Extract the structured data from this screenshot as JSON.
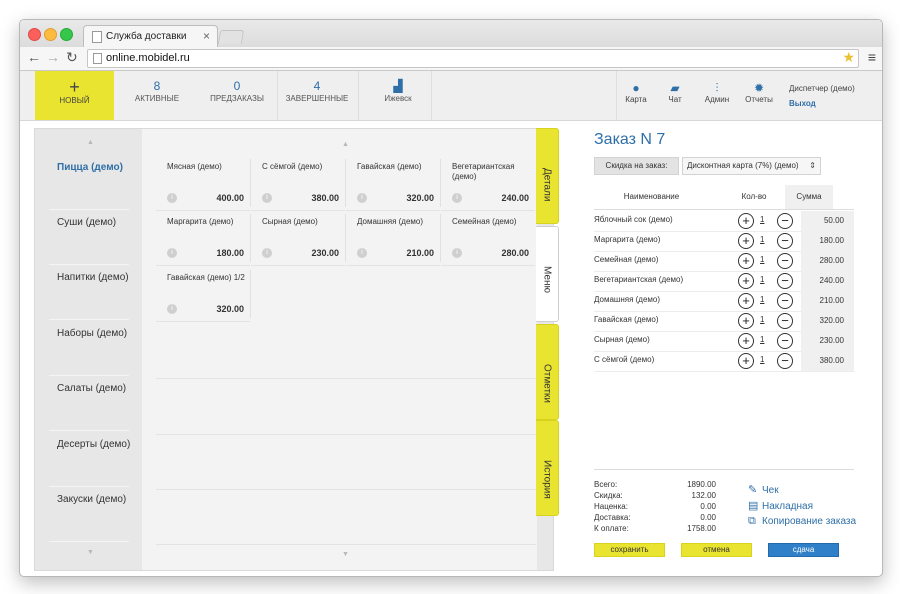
{
  "browser": {
    "tab_title": "Служба доставки",
    "tab_close": "×",
    "url": "online.mobidel.ru"
  },
  "toolbar": {
    "new_label": "НОВЫЙ",
    "new_plus": "+",
    "active": {
      "count": "8",
      "label": "АКТИВНЫЕ"
    },
    "preorders": {
      "count": "0",
      "label": "ПРЕДЗАКАЗЫ"
    },
    "completed": {
      "count": "4",
      "label": "ЗАВЕРШЕННЫЕ"
    },
    "city": "Ижевск",
    "right": [
      {
        "label": "Карта",
        "icon": "map-pin-icon"
      },
      {
        "label": "Чат",
        "icon": "chat-icon"
      },
      {
        "label": "Админ",
        "icon": "sliders-icon"
      },
      {
        "label": "Отчеты",
        "icon": "gear-icon"
      }
    ],
    "dispatcher": "Диспетчер (демо)",
    "logout": "Выход"
  },
  "categories": [
    "Пицца (демо)",
    "Суши (демо)",
    "Напитки (демо)",
    "Наборы (демо)",
    "Салаты (демо)",
    "Десерты (демо)",
    "Закуски (демо)"
  ],
  "products": [
    {
      "name": "Мясная (демо)",
      "price": "400.00"
    },
    {
      "name": "С сёмгой (демо)",
      "price": "380.00"
    },
    {
      "name": "Гавайская (демо)",
      "price": "320.00"
    },
    {
      "name": "Вегетариантская (демо)",
      "price": "240.00"
    },
    {
      "name": "Маргарита (демо)",
      "price": "180.00"
    },
    {
      "name": "Сырная (демо)",
      "price": "230.00"
    },
    {
      "name": "Домашняя (демо)",
      "price": "210.00"
    },
    {
      "name": "Семейная (демо)",
      "price": "280.00"
    },
    {
      "name": "Гавайская (демо) 1/2",
      "price": "320.00"
    }
  ],
  "side_tabs": [
    "Детали",
    "Меню",
    "Отметки",
    "История"
  ],
  "order": {
    "title": "Заказ N 7",
    "discount_label": "Скидка на заказ:",
    "discount_value": "Дисконтная карта (7%) (демо)",
    "columns": {
      "name": "Наименование",
      "qty": "Кол-во",
      "sum": "Сумма"
    },
    "rows": [
      {
        "name": "Яблочный сок (демо)",
        "qty": "1",
        "sum": "50.00"
      },
      {
        "name": "Маргарита (демо)",
        "qty": "1",
        "sum": "180.00"
      },
      {
        "name": "Семейная (демо)",
        "qty": "1",
        "sum": "280.00"
      },
      {
        "name": "Вегетариантская (демо)",
        "qty": "1",
        "sum": "240.00"
      },
      {
        "name": "Домашняя (демо)",
        "qty": "1",
        "sum": "210.00"
      },
      {
        "name": "Гавайская (демо)",
        "qty": "1",
        "sum": "320.00"
      },
      {
        "name": "Сырная (демо)",
        "qty": "1",
        "sum": "230.00"
      },
      {
        "name": "С сёмгой (демо)",
        "qty": "1",
        "sum": "380.00"
      }
    ],
    "totals": [
      {
        "label": "Всего:",
        "value": "1890.00"
      },
      {
        "label": "Скидка:",
        "value": "132.00"
      },
      {
        "label": "Наценка:",
        "value": "0.00"
      },
      {
        "label": "Доставка:",
        "value": "0.00"
      },
      {
        "label": "К оплате:",
        "value": "1758.00"
      }
    ],
    "links": [
      "Чек",
      "Накладная",
      "Копирование заказа"
    ],
    "buttons": {
      "save": "сохранить",
      "cancel": "отмена",
      "change": "сдача"
    }
  },
  "colors": {
    "accent_yellow": "#e9e430",
    "link_blue": "#2f6fa8",
    "button_blue": "#2f7fc9"
  }
}
